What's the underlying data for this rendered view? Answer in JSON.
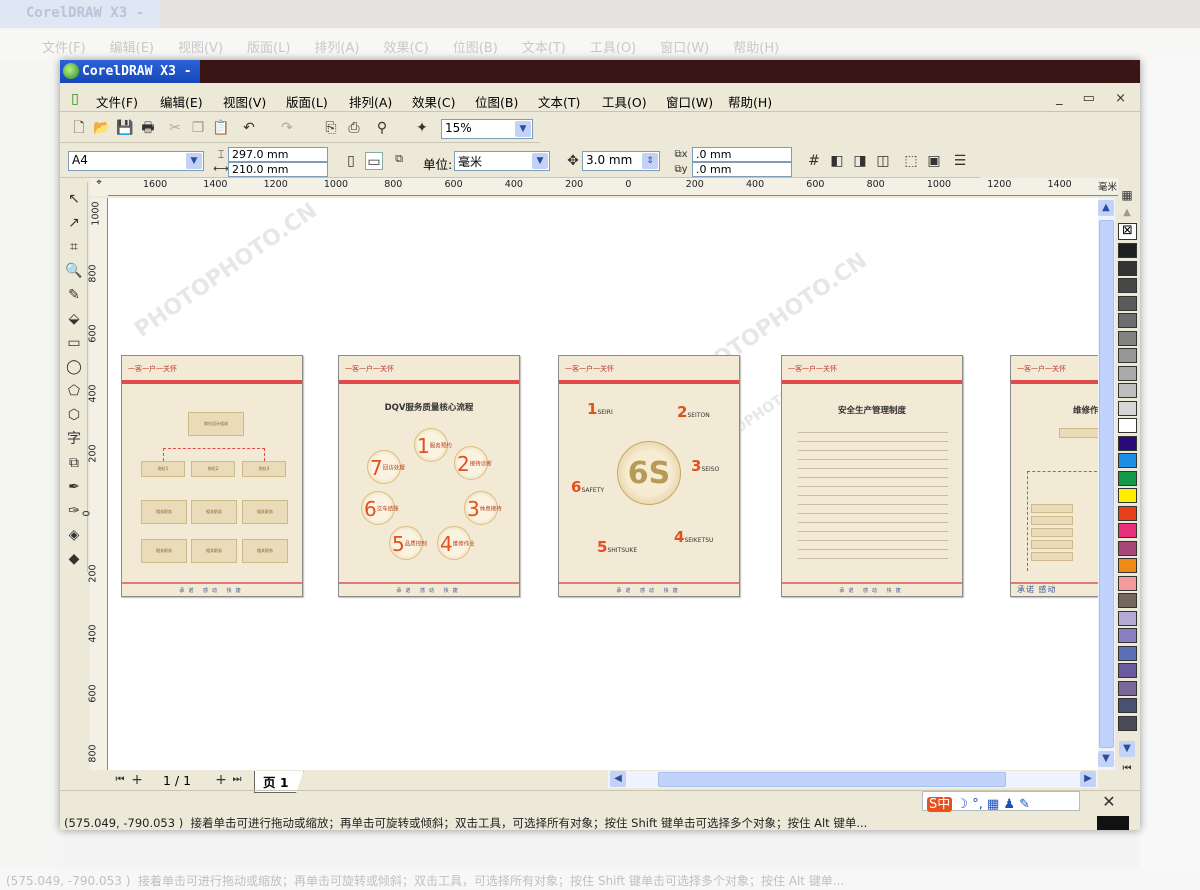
{
  "app": {
    "title": "CorelDRAW X3 -"
  },
  "menu": [
    "文件(F)",
    "编辑(E)",
    "视图(V)",
    "版面(L)",
    "排列(A)",
    "效果(C)",
    "位图(B)",
    "文本(T)",
    "工具(O)",
    "窗口(W)",
    "帮助(H)"
  ],
  "window_controls": "_ ▭ ×",
  "standard_toolbar": {
    "zoom_level": "15%"
  },
  "property_bar": {
    "paper_type": "A4",
    "height": "297.0 mm",
    "width": "210.0 mm",
    "unit_label": "单位:",
    "unit": "毫米",
    "nudge": "3.0 mm",
    "dup_x": ".0 mm",
    "dup_y": ".0 mm"
  },
  "ruler": {
    "horizontal": [
      "1600",
      "1400",
      "1200",
      "1000",
      "800",
      "600",
      "400",
      "200",
      "0",
      "200",
      "400",
      "600",
      "800",
      "1000",
      "1200",
      "1400"
    ],
    "unit": "毫米",
    "vertical": [
      "1000",
      "800",
      "600",
      "400",
      "200",
      "0",
      "200",
      "400",
      "600",
      "800"
    ]
  },
  "page_nav": {
    "counter": "1 / 1",
    "tab": "页 1"
  },
  "status": {
    "coords": "(575.049, -790.053 )",
    "hint": "接着单击可进行拖动或缩放；再单击可旋转或倾斜；双击工具，可选择所有对象；按住 Shift 键单击可选择多个对象；按住 Alt 键单..."
  },
  "ime": {
    "label": "S中",
    "icons": "☽ °, ▦ ♟ ✎"
  },
  "palette": [
    "#1e1e1e",
    "#333333",
    "#474747",
    "#5a5a5a",
    "#6e6e6e",
    "#828282",
    "#969696",
    "#aaaaaa",
    "#bebebe",
    "#d6d6d6",
    "#ffffff",
    "#2a0a78",
    "#1e8ee6",
    "#109a4a",
    "#ffee00",
    "#e8401a",
    "#e8307a",
    "#a84878",
    "#f08a14",
    "#f49a9a",
    "#74685e",
    "#b4aad6",
    "#8a80c0",
    "#5c70b8",
    "#6a5aa0",
    "#786898",
    "#4a5070",
    "#4a4a58"
  ],
  "pages": [
    {
      "brand": "一客一户一关怀",
      "footer": "承诺 感动 快捷",
      "boxes": {
        "top": "岗位设计组成",
        "mid": [
          "岗位1",
          "岗位2",
          "岗位3"
        ],
        "low": "相关职务"
      }
    },
    {
      "brand": "一客一户一关怀",
      "title": "DQV服务质量核心流程",
      "steps": [
        {
          "n": "1",
          "t": "服务预约"
        },
        {
          "n": "2",
          "t": "接待诊断"
        },
        {
          "n": "3",
          "t": "休息接待"
        },
        {
          "n": "4",
          "t": "维修作业"
        },
        {
          "n": "5",
          "t": "品质控制"
        },
        {
          "n": "6",
          "t": "交车结账"
        },
        {
          "n": "7",
          "t": "回访处理"
        }
      ],
      "footer": "承诺 感动 快捷"
    },
    {
      "brand": "一客一户一关怀",
      "center": "6S",
      "items": [
        {
          "n": "1",
          "t": "SEIRI"
        },
        {
          "n": "2",
          "t": "SEITON"
        },
        {
          "n": "3",
          "t": "SEISO"
        },
        {
          "n": "4",
          "t": "SEIKETSU"
        },
        {
          "n": "5",
          "t": "SHITSUKE"
        },
        {
          "n": "6",
          "t": "SAFETY"
        }
      ],
      "footer": "承诺 感动 快捷"
    },
    {
      "brand": "一客一户一关怀",
      "title": "安全生产管理制度",
      "footer": "承诺 感动 快捷"
    },
    {
      "brand": "一客一户一关怀",
      "title": "维修作",
      "footer": "承诺 感动"
    }
  ],
  "watermark": "PHOTOPHOTO.CN"
}
